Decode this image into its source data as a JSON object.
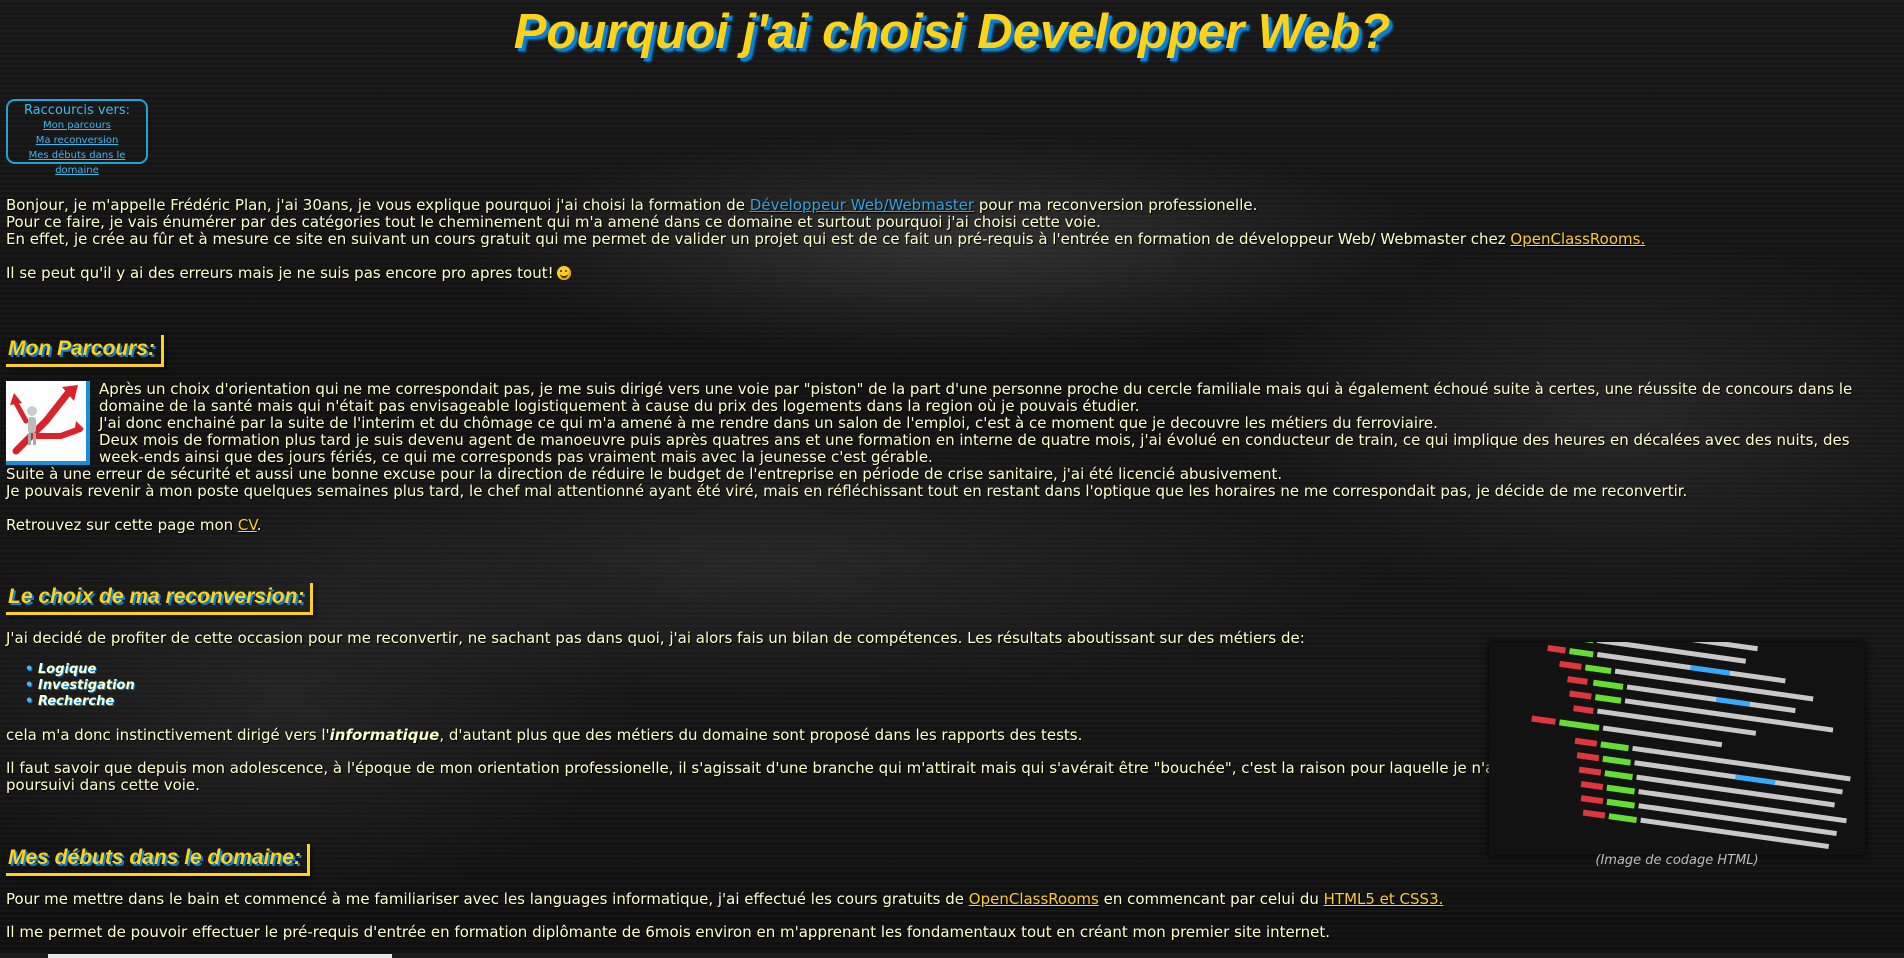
{
  "page_title": "Pourquoi j'ai choisi Developper Web?",
  "shortcuts": {
    "heading": "Raccourcis vers:",
    "links": [
      "Mon parcours",
      "Ma reconversion",
      "Mes débuts dans le domaine"
    ]
  },
  "intro": {
    "line1_before": "Bonjour, je m'appelle Frédéric Plan, j'ai 30ans, je vous explique pourquoi j'ai choisi la formation de ",
    "line1_link": "Développeur Web/Webmaster",
    "line1_after": " pour ma reconversion professionelle.",
    "line2": "Pour ce faire, je vais énumérer par des catégories tout le cheminement qui m'a amené dans ce domaine et surtout pourquoi j'ai choisi cette voie.",
    "line3_before": "En effet, je crée au fûr et à mesure ce site en suivant un cours gratuit qui me permet de valider un projet qui est de ce fait un pré-requis à l'entrée en formation de développeur Web/ Webmaster chez ",
    "line3_link": "OpenClassRooms.",
    "note": "Il se peut qu'il y ai des erreurs mais je ne suis pas encore pro apres tout!"
  },
  "parcours": {
    "heading": "Mon Parcours:",
    "p1": "Après un choix d'orientation qui ne me correspondait pas, je me suis dirigé vers une voie par \"piston\" de la part d'une personne proche du cercle familiale mais qui à également échoué suite à certes, une réussite de concours dans le domaine de la santé mais qui n'était pas envisageable logistiquement à cause du prix des logements dans la region où je pouvais étudier.",
    "p2": "J'ai donc enchainé par la suite de l'interim et du chômage ce qui m'a amené à me rendre dans un salon de l'emploi, c'est à ce moment que je decouvre les métiers du ferroviaire.",
    "p3": "Deux mois de formation plus tard je suis devenu agent de manoeuvre puis après quatres ans et une formation en interne de quatre mois, j'ai évolué en conducteur de train, ce qui implique des heures en décalées avec des nuits, des week-ends ainsi que des jours fériés, ce qui me corresponds pas vraiment mais avec la jeunesse c'est gérable.",
    "p4": "Suite à une erreur de sécurité et aussi une bonne excuse pour la direction de réduire le budget de l'entreprise en période de crise sanitaire, j'ai été licencié abusivement.",
    "p5": "Je pouvais revenir à mon poste quelques semaines plus tard, le chef mal attentionné ayant été viré, mais en réfléchissant tout en restant dans l'optique que les horaires ne me correspondait pas, je décide de me reconvertir.",
    "cv_before": "Retrouvez sur cette page mon ",
    "cv_link": "CV",
    "cv_after": "."
  },
  "reconversion": {
    "heading": "Le choix de ma reconversion:",
    "p1": "J'ai decidé de profiter de cette occasion pour me reconvertir, ne sachant pas dans quoi, j'ai alors fais un bilan de compétences. Les résultats aboutissant sur des métiers de:",
    "skills": [
      "Logique",
      "Investigation",
      "Recherche"
    ],
    "p2_before": "cela m'a donc instinctivement dirigé vers l'",
    "p2_bold": "informatique",
    "p2_after": ", d'autant plus que des métiers du domaine sont proposé dans les rapports des tests.",
    "p3_line1": "Il faut savoir que depuis mon adolescence, à l'époque de mon orientation professionelle, il s'agissait d'une branche qui m'attirait mais qui s'avérait être \"bouchée\", c'est la raison pour laquelle je n'ai pas",
    "p3_line2": "poursuivi dans cette voie.",
    "image_caption": "(Image de codage HTML)"
  },
  "debuts": {
    "heading": "Mes débuts dans le domaine:",
    "p1_before": "Pour me mettre dans le bain et commencé à me familiariser avec les languages informatique, j'ai effectué les cours gratuits de ",
    "p1_link1": "OpenClassRooms",
    "p1_middle": " en commencant par celui du ",
    "p1_link2": "HTML5 et CSS3.",
    "p2": "Il me permet de pouvoir effectuer le pré-requis d'entrée en formation diplômante de 6mois environ en m'apprenant les fondamentaux tout en créant mon premier site internet."
  },
  "colors": {
    "accent_gold": "#ffd21a",
    "accent_blue": "#0b7fd6",
    "link_gold": "#ffcc22",
    "body_text": "#ffffcc"
  }
}
